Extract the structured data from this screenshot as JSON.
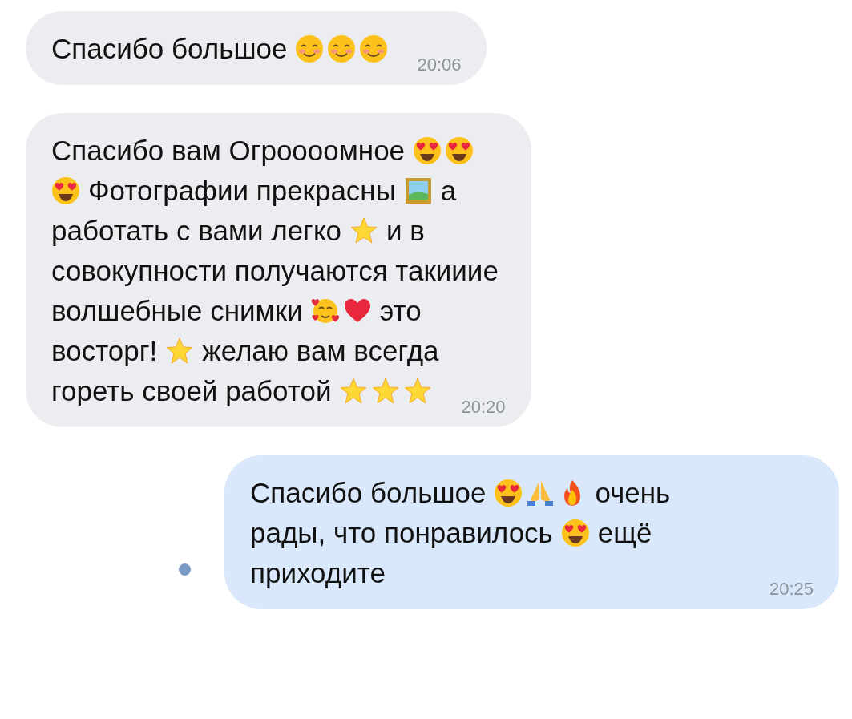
{
  "messages": [
    {
      "outgoing": false,
      "read": true,
      "time": "20:06",
      "lines": [
        [
          {
            "kind": "text",
            "text": "Спасибо большое"
          },
          {
            "kind": "smile"
          },
          {
            "kind": "smile"
          },
          {
            "kind": "smile"
          }
        ]
      ]
    },
    {
      "outgoing": false,
      "read": true,
      "time": "20:20",
      "lines": [
        [
          {
            "kind": "text",
            "text": "Спасибо вам Огроооомное"
          },
          {
            "kind": "hearteyes"
          },
          {
            "kind": "hearteyes"
          }
        ],
        [
          {
            "kind": "hearteyes"
          },
          {
            "kind": "text",
            "text": "Фотографии прекрасны"
          },
          {
            "kind": "picture"
          },
          {
            "kind": "text",
            "text": "а"
          }
        ],
        [
          {
            "kind": "text",
            "text": "работать с вами легко"
          },
          {
            "kind": "star"
          },
          {
            "kind": "text",
            "text": "и в"
          }
        ],
        [
          {
            "kind": "text",
            "text": "совокупности получаются такииие"
          }
        ],
        [
          {
            "kind": "text",
            "text": "волшебные снимки"
          },
          {
            "kind": "lovingface"
          },
          {
            "kind": "heart"
          },
          {
            "kind": "text",
            "text": "это"
          }
        ],
        [
          {
            "kind": "text",
            "text": "восторг!"
          },
          {
            "kind": "star"
          },
          {
            "kind": "text",
            "text": "желаю вам всегда"
          }
        ],
        [
          {
            "kind": "text",
            "text": "гореть своей работой"
          },
          {
            "kind": "star"
          },
          {
            "kind": "star"
          },
          {
            "kind": "star"
          }
        ]
      ]
    },
    {
      "outgoing": true,
      "read": false,
      "time": "20:25",
      "lines": [
        [
          {
            "kind": "text",
            "text": "Спасибо большое"
          },
          {
            "kind": "hearteyes"
          },
          {
            "kind": "pray"
          },
          {
            "kind": "fire"
          },
          {
            "kind": "text",
            "text": "очень"
          }
        ],
        [
          {
            "kind": "text",
            "text": "рады, что понравилось"
          },
          {
            "kind": "hearteyes"
          },
          {
            "kind": "text",
            "text": "ещё"
          }
        ],
        [
          {
            "kind": "text",
            "text": "приходите"
          }
        ]
      ]
    }
  ]
}
